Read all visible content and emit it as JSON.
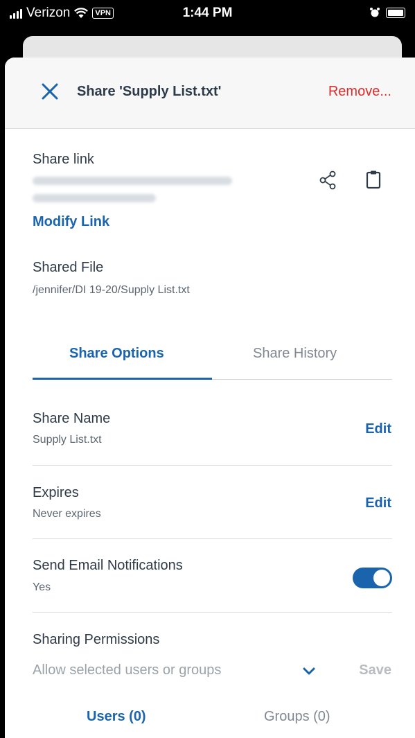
{
  "status_bar": {
    "carrier": "Verizon",
    "vpn": "VPN",
    "time": "1:44 PM"
  },
  "header": {
    "title": "Share 'Supply List.txt'",
    "remove_label": "Remove..."
  },
  "share_link": {
    "label": "Share link",
    "modify_label": "Modify Link"
  },
  "shared_file": {
    "label": "Shared File",
    "path": "/jennifer/DI 19-20/Supply List.txt"
  },
  "tabs": [
    {
      "label": "Share Options",
      "active": true
    },
    {
      "label": "Share History",
      "active": false
    }
  ],
  "options": {
    "share_name": {
      "title": "Share Name",
      "value": "Supply List.txt",
      "action": "Edit"
    },
    "expires": {
      "title": "Expires",
      "value": "Never expires",
      "action": "Edit"
    },
    "email_notifications": {
      "title": "Send Email Notifications",
      "value": "Yes",
      "enabled": true
    },
    "sharing_permissions": {
      "title": "Sharing Permissions",
      "selected": "Allow selected users or groups",
      "save_label": "Save"
    }
  },
  "subtabs": [
    {
      "label": "Users (0)",
      "active": true
    },
    {
      "label": "Groups (0)",
      "active": false
    }
  ],
  "colors": {
    "accent": "#1a63ad",
    "danger": "#e02b2b",
    "text": "#2f3a48"
  }
}
